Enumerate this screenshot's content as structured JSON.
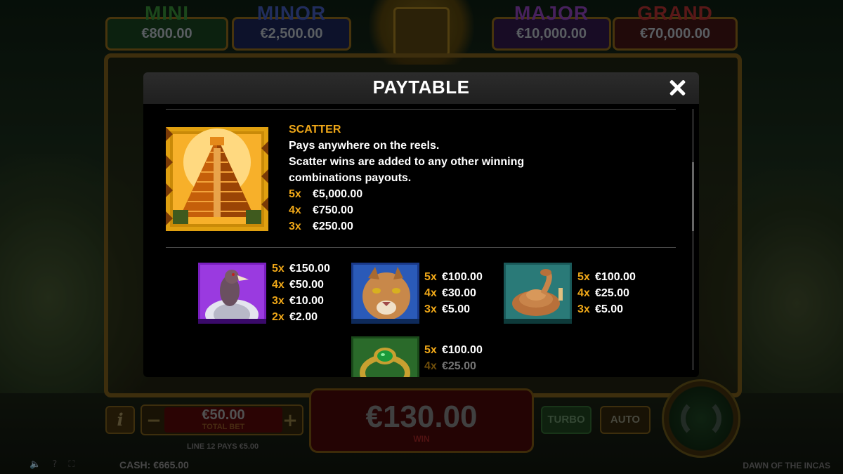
{
  "jackpots": [
    {
      "title": "MINI",
      "value": "€800.00"
    },
    {
      "title": "MINOR",
      "value": "€2,500.00"
    },
    {
      "title": "MAJOR",
      "value": "€10,000.00"
    },
    {
      "title": "GRAND",
      "value": "€70,000.00"
    }
  ],
  "modal": {
    "title": "PAYTABLE",
    "scatter": {
      "title": "SCATTER",
      "desc_line1": "Pays anywhere on the reels.",
      "desc_line2": "Scatter wins are added to any other winning combinations payouts.",
      "pays": [
        {
          "count": "5x",
          "amount": "€5,000.00"
        },
        {
          "count": "4x",
          "amount": "€750.00"
        },
        {
          "count": "3x",
          "amount": "€250.00"
        }
      ]
    },
    "symbols": [
      {
        "name": "condor",
        "pays": [
          {
            "count": "5x",
            "amount": "€150.00"
          },
          {
            "count": "4x",
            "amount": "€50.00"
          },
          {
            "count": "3x",
            "amount": "€10.00"
          },
          {
            "count": "2x",
            "amount": "€2.00"
          }
        ]
      },
      {
        "name": "puma",
        "pays": [
          {
            "count": "5x",
            "amount": "€100.00"
          },
          {
            "count": "4x",
            "amount": "€30.00"
          },
          {
            "count": "3x",
            "amount": "€5.00"
          }
        ]
      },
      {
        "name": "rattlesnake",
        "pays": [
          {
            "count": "5x",
            "amount": "€100.00"
          },
          {
            "count": "4x",
            "amount": "€25.00"
          },
          {
            "count": "3x",
            "amount": "€5.00"
          }
        ]
      },
      {
        "name": "emerald-ring",
        "pays": [
          {
            "count": "5x",
            "amount": "€100.00"
          },
          {
            "count": "4x",
            "amount": "€25.00"
          }
        ]
      }
    ]
  },
  "bottom": {
    "total_bet_value": "€50.00",
    "total_bet_label": "TOTAL BET",
    "line_info": "LINE 12 PAYS €5.00",
    "win_value": "€130.00",
    "win_label": "WIN",
    "turbo_label": "TURBO",
    "auto_label": "AUTO",
    "info_label": "i",
    "minus_label": "−",
    "plus_label": "+",
    "cash_label": "CASH:",
    "cash_value": "€665.00",
    "game_title": "DAWN OF THE INCAS"
  },
  "colors": {
    "accent": "#f0a818",
    "modal_bg": "#000000",
    "header_bg": "#2a2a2a"
  },
  "icons": [
    "close-icon",
    "pyramid-scatter-icon",
    "condor-icon",
    "puma-icon",
    "rattlesnake-icon",
    "emerald-ring-icon",
    "sound-icon",
    "help-icon",
    "fullscreen-icon",
    "spin-icon"
  ]
}
